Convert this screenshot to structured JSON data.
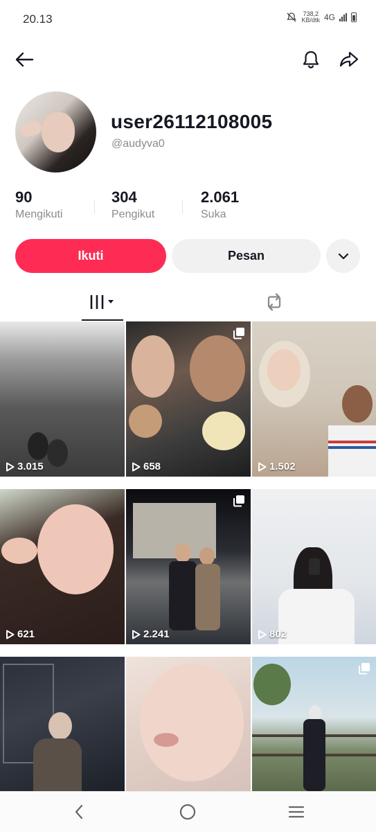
{
  "status_bar": {
    "time": "20.13",
    "data_rate_value": "738,2",
    "data_rate_unit": "KB/dtk",
    "network": "4G"
  },
  "profile": {
    "username": "user26112108005",
    "handle": "@audyva0"
  },
  "stats": [
    {
      "value": "90",
      "label": "Mengikuti"
    },
    {
      "value": "304",
      "label": "Pengikut"
    },
    {
      "value": "2.061",
      "label": "Suka"
    }
  ],
  "actions": {
    "follow_label": "Ikuti",
    "message_label": "Pesan"
  },
  "videos": [
    {
      "views": "3.015",
      "multi": false
    },
    {
      "views": "658",
      "multi": true
    },
    {
      "views": "1.502",
      "multi": false
    },
    {
      "views": "621",
      "multi": false
    },
    {
      "views": "2.241",
      "multi": true
    },
    {
      "views": "802",
      "multi": false
    },
    {
      "views": "",
      "multi": false
    },
    {
      "views": "",
      "multi": false
    },
    {
      "views": "",
      "multi": true
    }
  ],
  "icons": [
    "back-arrow-icon",
    "bell-icon",
    "share-icon",
    "chevron-down-icon",
    "videos-grid-icon",
    "repost-icon",
    "play-icon",
    "nav-back-icon",
    "nav-home-icon",
    "nav-menu-icon"
  ],
  "colors": {
    "accent": "#fe2c55",
    "text": "#161823",
    "muted": "#8a8b91",
    "button_bg": "#f1f1f2"
  }
}
